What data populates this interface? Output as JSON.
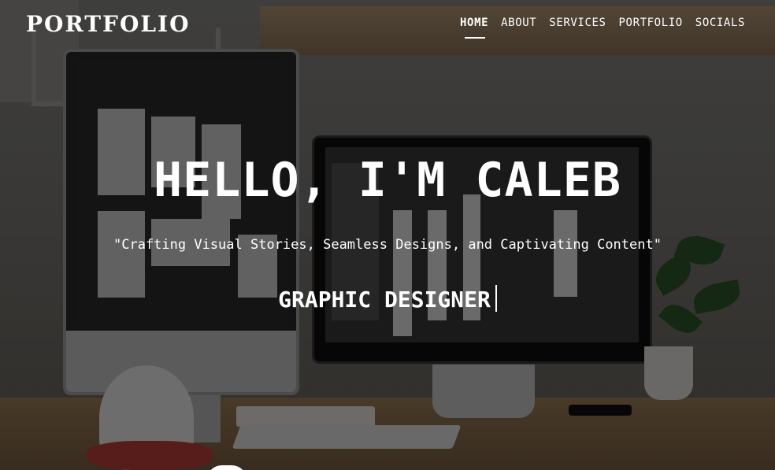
{
  "header": {
    "brand": "PORTFOLIO",
    "nav": [
      {
        "label": "HOME",
        "active": true
      },
      {
        "label": "ABOUT",
        "active": false
      },
      {
        "label": "SERVICES",
        "active": false
      },
      {
        "label": "PORTFOLIO",
        "active": false
      },
      {
        "label": "SOCIALS",
        "active": false
      }
    ]
  },
  "hero": {
    "title": "HELLO, I'M CALEB",
    "tagline": "\"Crafting Visual Stories, Seamless Designs, and Captivating Content\"",
    "role": "GRAPHIC DESIGNER"
  },
  "colors": {
    "text": "#ffffff",
    "overlay": "rgba(0,0,0,0.55)"
  },
  "icons": {
    "typing_caret": "text-cursor-icon"
  }
}
